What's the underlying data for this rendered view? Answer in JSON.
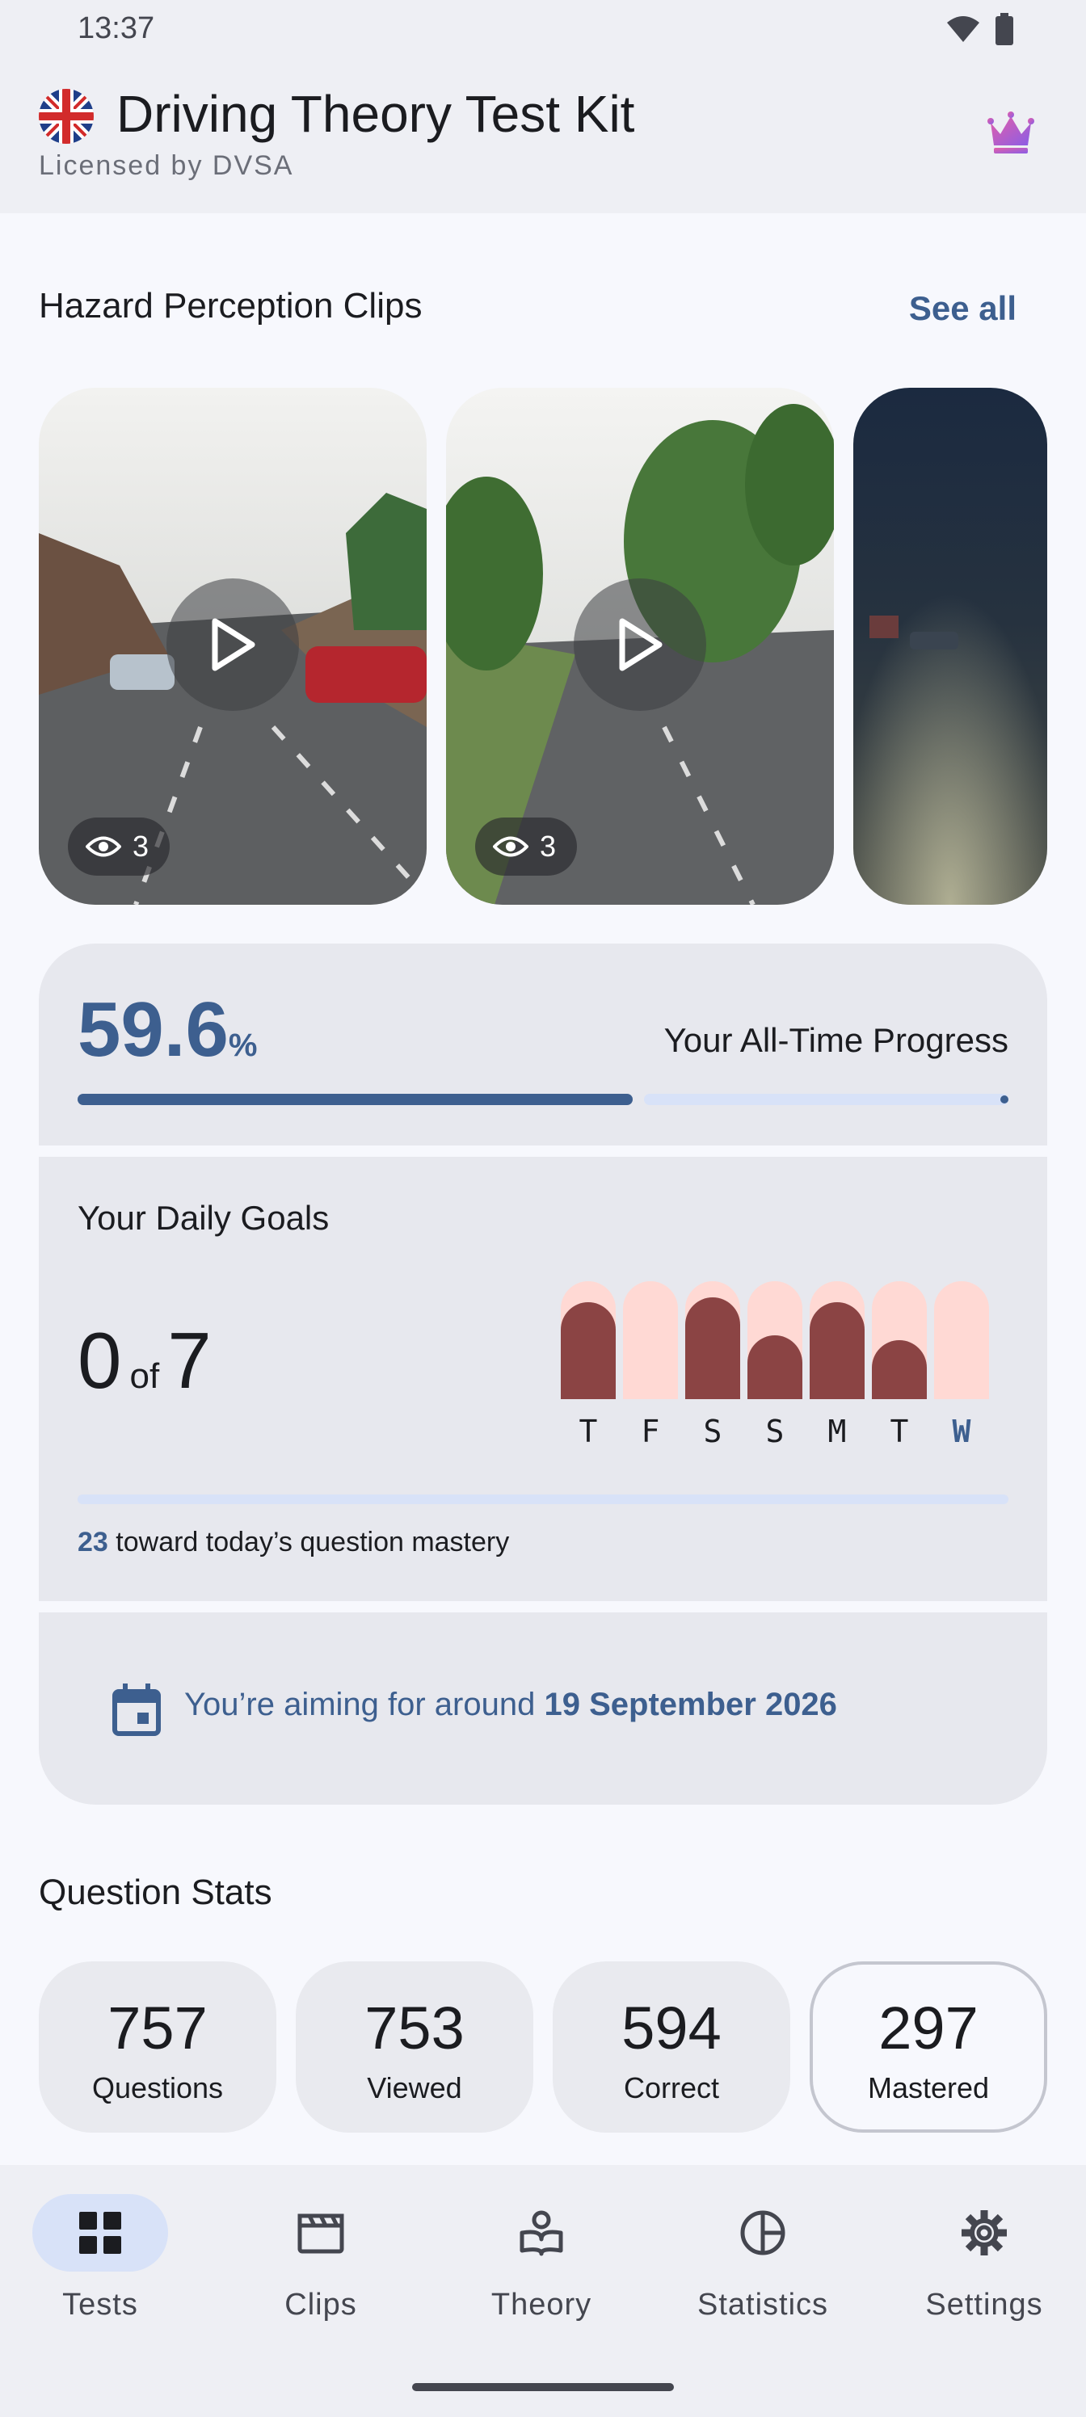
{
  "status_bar": {
    "time": "13:37",
    "icons": [
      "wifi-icon",
      "battery-icon"
    ]
  },
  "header": {
    "title": "Driving Theory Test Kit",
    "subtitle": "Licensed by DVSA",
    "premium_icon": "crown-icon"
  },
  "clips_section": {
    "title": "Hazard Perception Clips",
    "see_all": "See all",
    "clips": [
      {
        "views": "3",
        "scene": "suburban street, parked cars"
      },
      {
        "views": "3",
        "scene": "tree-lined road"
      },
      {
        "scene": "dual carriageway at night"
      }
    ]
  },
  "progress": {
    "value": "59.6",
    "unit": "%",
    "label": "Your All-Time Progress",
    "fraction": 0.596
  },
  "daily_goals": {
    "title": "Your Daily Goals",
    "done": "0",
    "of": "of",
    "total": "7",
    "days": [
      {
        "label": "T",
        "level": 0.82
      },
      {
        "label": "F",
        "level": 0
      },
      {
        "label": "S",
        "level": 0.86
      },
      {
        "label": "S",
        "level": 0.54
      },
      {
        "label": "M",
        "level": 0.82
      },
      {
        "label": "T",
        "level": 0.5
      },
      {
        "label": "W",
        "level": 0,
        "today": true
      }
    ],
    "mastery_count": "23",
    "mastery_text": "toward today’s question mastery"
  },
  "target": {
    "prefix": "You’re aiming for around",
    "date": "19 September 2026"
  },
  "question_stats": {
    "title": "Question Stats",
    "items": [
      {
        "value": "757",
        "label": "Questions"
      },
      {
        "value": "753",
        "label": "Viewed"
      },
      {
        "value": "594",
        "label": "Correct"
      },
      {
        "value": "297",
        "label": "Mastered"
      }
    ]
  },
  "nav": {
    "items": [
      {
        "label": "Tests",
        "icon": "grid-icon"
      },
      {
        "label": "Clips",
        "icon": "clapperboard-icon"
      },
      {
        "label": "Theory",
        "icon": "reader-icon"
      },
      {
        "label": "Statistics",
        "icon": "pie-chart-icon"
      },
      {
        "label": "Settings",
        "icon": "gear-icon"
      }
    ],
    "active": "Tests"
  },
  "colors": {
    "primary": "#3d5f8f",
    "bar_fill": "#8b4444",
    "bar_bg": "#ffd9d4"
  }
}
